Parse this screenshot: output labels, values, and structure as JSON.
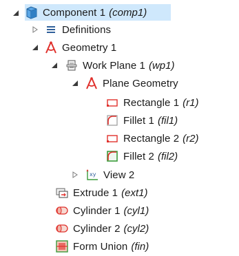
{
  "tree": {
    "component": {
      "label": "Component 1",
      "tag": "(comp1)",
      "selected": true
    },
    "definitions": {
      "label": "Definitions"
    },
    "geometry": {
      "label": "Geometry 1"
    },
    "work_plane": {
      "label": "Work Plane 1",
      "tag": "(wp1)"
    },
    "plane_geometry": {
      "label": "Plane Geometry"
    },
    "rectangle1": {
      "label": "Rectangle 1",
      "tag": "(r1)"
    },
    "fillet1": {
      "label": "Fillet 1",
      "tag": "(fil1)"
    },
    "rectangle2": {
      "label": "Rectangle 2",
      "tag": "(r2)"
    },
    "fillet2": {
      "label": "Fillet 2",
      "tag": "(fil2)"
    },
    "view2": {
      "label": "View 2"
    },
    "extrude1": {
      "label": "Extrude 1",
      "tag": "(ext1)"
    },
    "cylinder1": {
      "label": "Cylinder 1",
      "tag": "(cyl1)"
    },
    "cylinder2": {
      "label": "Cylinder 2",
      "tag": "(cyl2)"
    },
    "form_union": {
      "label": "Form Union",
      "tag": "(fin)"
    }
  },
  "colors": {
    "selection": "#cfe8fc",
    "geometry_red": "#e0312c",
    "fillet_green": "#3b9b3b",
    "component_blue": "#1e78c8"
  },
  "icons": {
    "component": "component-cube-icon",
    "definitions": "definitions-list-icon",
    "geometry": "geometry-compass-icon",
    "work_plane": "work-plane-icon",
    "rectangle": "rectangle-icon",
    "fillet": "fillet-icon",
    "view": "view-axes-icon",
    "extrude": "extrude-icon",
    "cylinder": "cylinder-icon",
    "form_union": "form-union-icon"
  }
}
